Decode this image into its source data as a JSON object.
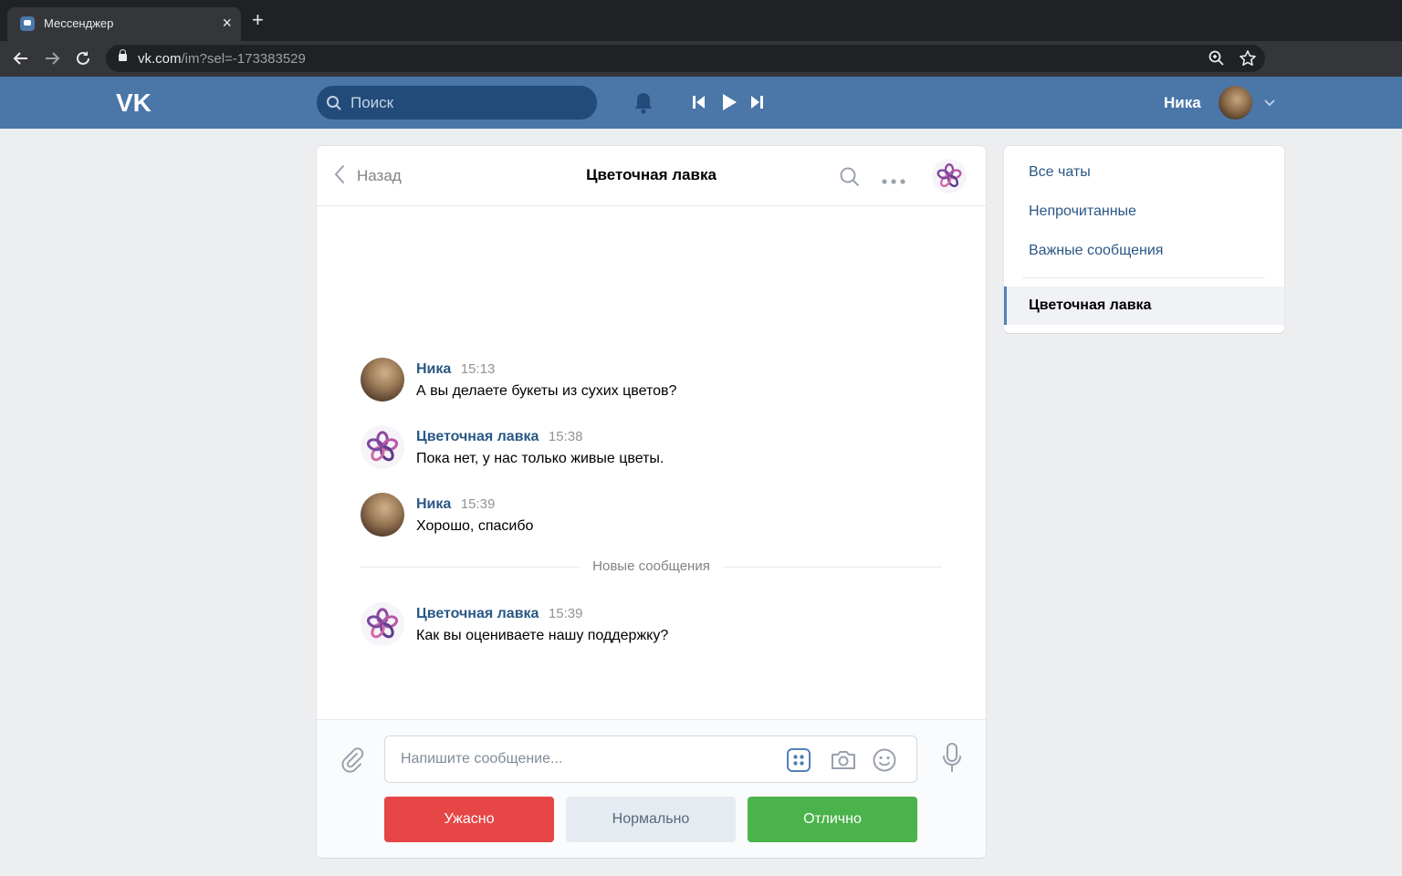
{
  "browser": {
    "tab_title": "Мессенджер",
    "url_host": "vk.com",
    "url_path": "/im?sel=-173383529"
  },
  "header": {
    "search_placeholder": "Поиск",
    "user_name": "Ника",
    "brand_color": "#4a76a8"
  },
  "chat": {
    "back_label": "Назад",
    "title": "Цветочная лавка",
    "new_messages_label": "Новые сообщения",
    "messages": [
      {
        "author": "Ника",
        "time": "15:13",
        "text": "А вы делаете букеты из сухих цветов?",
        "avatar": "user-photo"
      },
      {
        "author": "Цветочная лавка",
        "time": "15:38",
        "text": "Пока нет, у нас только живые цветы.",
        "avatar": "flower-logo"
      },
      {
        "author": "Ника",
        "time": "15:39",
        "text": "Хорошо, спасибо",
        "avatar": "user-photo"
      },
      {
        "author": "Цветочная лавка",
        "time": "15:39",
        "text": "Как вы оцениваете нашу поддержку?",
        "avatar": "flower-logo"
      }
    ],
    "composer_placeholder": "Напишите сообщение...",
    "keyboard": [
      {
        "label": "Ужасно",
        "color": "#e64646"
      },
      {
        "label": "Нормально",
        "color": "#e5ebf1"
      },
      {
        "label": "Отлично",
        "color": "#4bb34b"
      }
    ]
  },
  "menu": {
    "items": [
      "Все чаты",
      "Непрочитанные",
      "Важные сообщения"
    ],
    "active": "Цветочная лавка"
  }
}
